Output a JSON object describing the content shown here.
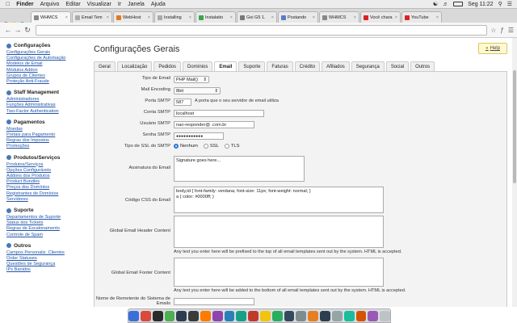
{
  "menubar": {
    "apple": "",
    "app": "Finder",
    "items": [
      "Arquivo",
      "Editar",
      "Visualizar",
      "Ir",
      "Janela",
      "Ajuda"
    ],
    "battery": "",
    "clock": "Seg 11:22"
  },
  "browser": {
    "tabs": [
      {
        "label": "WHMCS",
        "color": "#888"
      },
      {
        "label": "Email Tem",
        "color": "#aaa"
      },
      {
        "label": "WebHost",
        "color": "#e07a1f"
      },
      {
        "label": "Installing",
        "color": "#aaa"
      },
      {
        "label": "Instalatio",
        "color": "#3aa64a"
      },
      {
        "label": "Goi G5 1.",
        "color": "#777"
      },
      {
        "label": "Postando",
        "color": "#5a7cc4"
      },
      {
        "label": "WHMCS",
        "color": "#888"
      },
      {
        "label": "Você chara",
        "color": "#d22"
      },
      {
        "label": "YouTube",
        "color": "#d22"
      }
    ],
    "url": "",
    "toolbar_icons": [
      "star-icon",
      "ext-icon",
      "menu-icon"
    ]
  },
  "sidebar": [
    {
      "title": "Configurações",
      "items": [
        "Configurações Gerais",
        "Configurações de Automação",
        "Modelos de Email",
        "Módulos Addon",
        "Grupos de Clientes",
        "Proteção Anti-Fraude"
      ]
    },
    {
      "title": "Staff Management",
      "items": [
        "Administradores",
        "Funções Administrativas",
        "Two-Factor Authentication"
      ]
    },
    {
      "title": "Pagamentos",
      "items": [
        "Moedas",
        "Portais para Pagamento",
        "Regras dos Impostos",
        "Promoções"
      ]
    },
    {
      "title": "Produtos/Serviços",
      "items": [
        "Produtos/Serviços",
        "Opções Configuráveis",
        "Addons dos Produtos",
        "Product Bundles",
        "Preços dos Domínios",
        "Registrantes de Domínios",
        "Servidores"
      ]
    },
    {
      "title": "Suporte",
      "items": [
        "Departamentos de Suporte",
        "Status dos Tickets",
        "Regras de Escalonamento",
        "Controle de Spam"
      ]
    },
    {
      "title": "Outros",
      "items": [
        "Campos Personaliz. Clientes",
        "Order Statuses",
        "Questões de Segurança",
        "IPs Banidos"
      ]
    }
  ],
  "page": {
    "title": "Configurações Gerais",
    "help": "Help",
    "tabs": [
      "Geral",
      "Localização",
      "Pedidos",
      "Domínios",
      "Email",
      "Suporte",
      "Faturas",
      "Crédito",
      "Afiliados",
      "Segurança",
      "Social",
      "Outros"
    ],
    "active_tab": "Email"
  },
  "form": {
    "tipo_email": {
      "label": "Tipo de Email",
      "value": "PHP Mail()"
    },
    "mail_encoding": {
      "label": "Mail Encoding",
      "value": "8bit"
    },
    "porta": {
      "label": "Porta SMTP",
      "value": "587",
      "hint": "A porta que o seu servidor de email utiliza"
    },
    "conta": {
      "label": "Conta SMTP",
      "value": "localhost"
    },
    "usuario": {
      "label": "Usuário SMTP",
      "value": "nao-responder@            .com.br"
    },
    "senha": {
      "label": "Senha SMTP",
      "value": "●●●●●●●●●●●"
    },
    "ssl": {
      "label": "Tipo de SSL do SMTP",
      "options": [
        "Nenhum",
        "SSL",
        "TLS"
      ],
      "selected": "Nenhum"
    },
    "assinatura": {
      "label": "Assinatura do Email",
      "value": "Signature goes here..."
    },
    "css": {
      "label": "Código CSS do Email",
      "value": "body,td { font-family: verdana; font-size: 11px; font-weight: normal; }\na { color: #0000ff; }"
    },
    "header": {
      "label": "Global Email Header Content",
      "value": "",
      "note": "Any text you enter here will be prefixed to the top of all email templates sent out by the system. HTML is accepted."
    },
    "footer": {
      "label": "Global Email Footer Content",
      "value": "",
      "note": "Any text you enter here will be added to the bottom of all email templates sent out by the system. HTML is accepted."
    },
    "remetente": {
      "label": "Nome de Remetente do Sistema de Emails",
      "value": ""
    }
  },
  "dock": {
    "icons": [
      "#3a6fd8",
      "#d94a3a",
      "#2b2b2b",
      "#4caf50",
      "#2e3c50",
      "#3a3a3a",
      "#ff7a00",
      "#8e44ad",
      "#2980b9",
      "#16a085",
      "#c0392b",
      "#f1c40f",
      "#27ae60",
      "#34495e",
      "#7f8c8d",
      "#e67e22",
      "#2c3e50",
      "#95a5a6",
      "#1abc9c",
      "#d35400",
      "#9b59b6",
      "#bdc3c7"
    ]
  }
}
